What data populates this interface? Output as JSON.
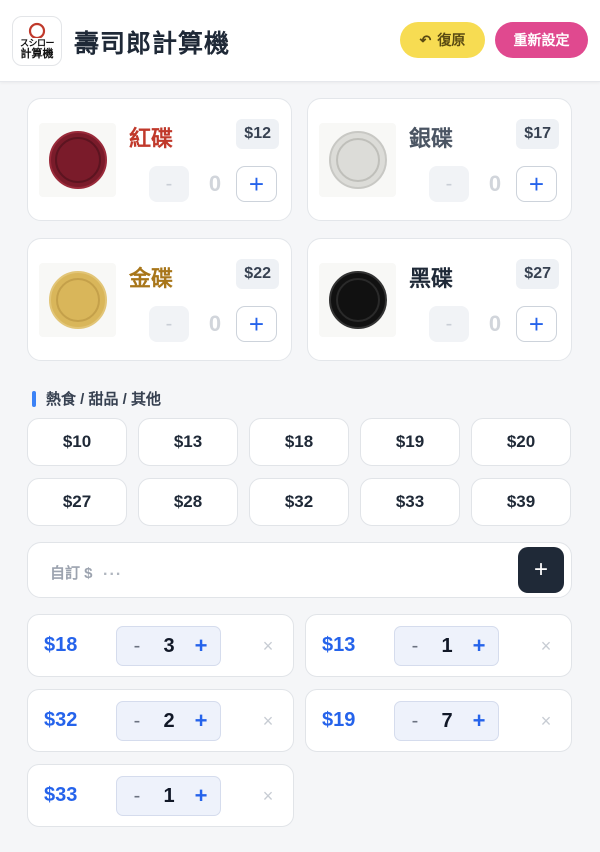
{
  "header": {
    "title": "壽司郎計算機",
    "logo": {
      "top": "スシロー",
      "bottom": "計算機"
    },
    "restore_label": "復原",
    "reset_label": "重新設定",
    "restore_color": "#f7dc52",
    "reset_color": "#e0498f"
  },
  "plates": [
    {
      "name": "紅碟",
      "price": "$12",
      "qty": "0",
      "name_color": "#c0392b",
      "plate_color": "#7a1b2a"
    },
    {
      "name": "銀碟",
      "price": "$17",
      "qty": "0",
      "name_color": "#4b5563",
      "plate_color": "#d9d9d6"
    },
    {
      "name": "金碟",
      "price": "$22",
      "qty": "0",
      "name_color": "#a8761a",
      "plate_color": "#d9b65a"
    },
    {
      "name": "黑碟",
      "price": "$27",
      "qty": "0",
      "name_color": "#1f2937",
      "plate_color": "#111111"
    }
  ],
  "section": {
    "label": "熱食 / 甜品 / 其他"
  },
  "prices": [
    "$10",
    "$13",
    "$18",
    "$19",
    "$20",
    "$27",
    "$28",
    "$32",
    "$33",
    "$39"
  ],
  "custom": {
    "prefix": "自訂 $",
    "placeholder": "...",
    "value": ""
  },
  "items": [
    {
      "price": "$18",
      "qty": "3"
    },
    {
      "price": "$13",
      "qty": "1"
    },
    {
      "price": "$32",
      "qty": "2"
    },
    {
      "price": "$19",
      "qty": "7"
    },
    {
      "price": "$33",
      "qty": "1"
    }
  ],
  "symbols": {
    "minus": "-",
    "plus": "+",
    "remove": "×",
    "restore_icon": "↶"
  },
  "accent": "#2563eb"
}
